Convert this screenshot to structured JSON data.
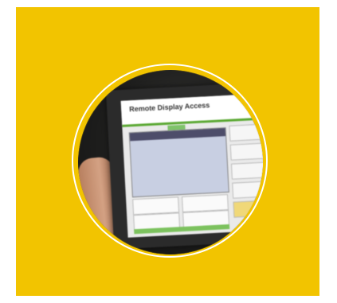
{
  "photo": {
    "screen": {
      "title": "Remote Display Access",
      "subtitle": ""
    }
  },
  "colors": {
    "panel": "#f2c400",
    "ring": "#ffffff",
    "screen_accent": "#5aa832"
  }
}
